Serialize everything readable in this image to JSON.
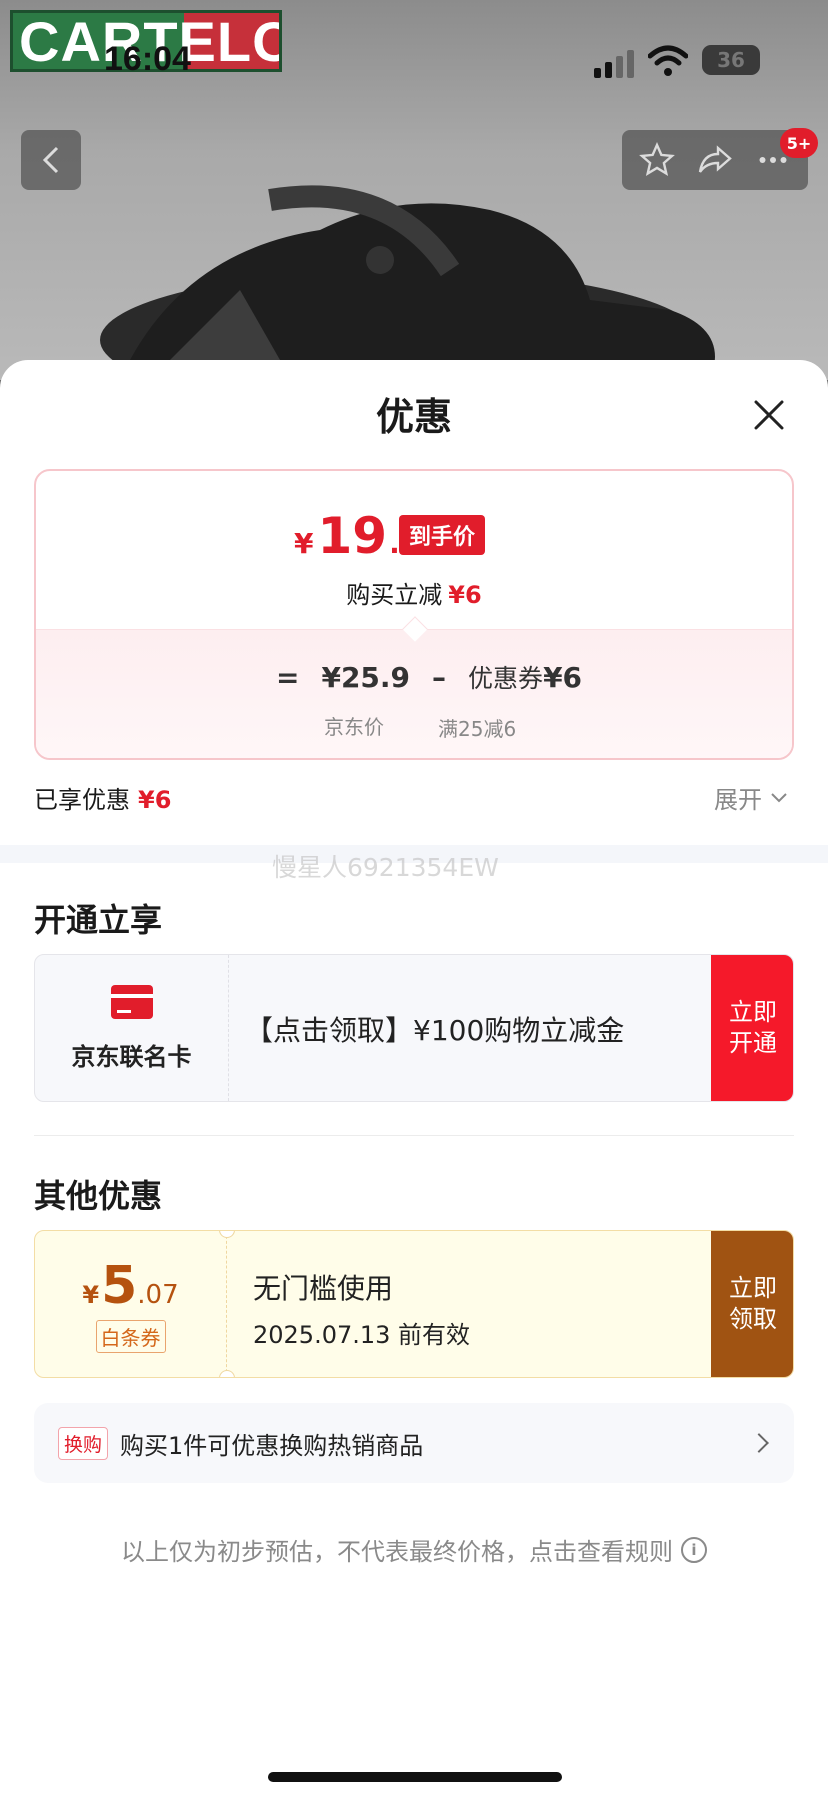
{
  "status_bar": {
    "time": "16:04",
    "battery": "36"
  },
  "background": {
    "logo_text": "CARTELO",
    "more_badge": "5+"
  },
  "sheet": {
    "title": "优惠",
    "price_card": {
      "currency": "¥",
      "final_int": "19",
      "final_dec": ".9",
      "final_tag": "到手价",
      "instant_label": "购买立减",
      "instant_value": "¥6",
      "equals": "=",
      "jd_price": "¥25.9",
      "minus": "–",
      "coupon_label": "优惠券",
      "coupon_value": "¥6",
      "jd_price_label": "京东价",
      "coupon_condition": "满25减6"
    },
    "enjoyed_label": "已享优惠",
    "enjoyed_value": "¥6",
    "expand_label": "展开",
    "watermark": "慢星人6921354EW",
    "section_open": {
      "title": "开通立享",
      "card_name": "京东联名卡",
      "desc": "【点击领取】¥100购物立减金",
      "button": "立即\n开通"
    },
    "section_other": {
      "title": "其他优惠",
      "coupon": {
        "currency": "¥",
        "amount_int": "5",
        "amount_dec": ".07",
        "type": "白条券",
        "title": "无门槛使用",
        "expiry": "2025.07.13 前有效",
        "button": "立即\n领取"
      },
      "swap": {
        "tag": "换购",
        "text": "购买1件可优惠换购热销商品"
      }
    },
    "footnote": "以上仅为初步预估，不代表最终价格，点击查看规则"
  },
  "colors": {
    "accent_red": "#e11d2b",
    "coupon_brown": "#a05312",
    "card_red": "#f5192a"
  }
}
